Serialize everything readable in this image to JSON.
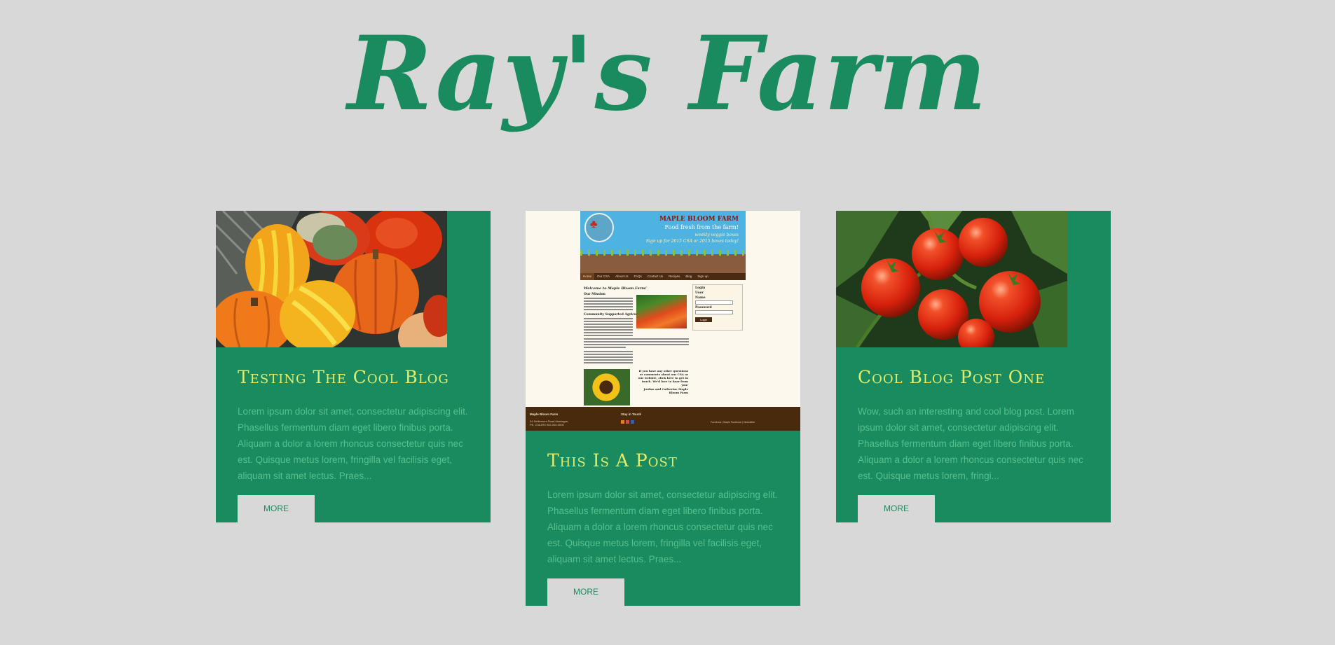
{
  "site": {
    "title": "Ray's Farm"
  },
  "posts": [
    {
      "title": "Testing The Cool Blog",
      "excerpt": "Lorem ipsum dolor sit amet, consectetur adipiscing elit. Phasellus fermentum diam eget libero finibus porta. Aliquam a dolor a lorem rhoncus consectetur quis nec est. Quisque metus lorem, fringilla vel facilisis eget, aliquam sit amet lectus. Praes...",
      "more_label": "MORE",
      "image": "pumpkins-and-gourds-photo"
    },
    {
      "title": "This Is A Post",
      "excerpt": "Lorem ipsum dolor sit amet, consectetur adipiscing elit. Phasellus fermentum diam eget libero finibus porta. Aliquam a dolor a lorem rhoncus consectetur quis nec est. Quisque metus lorem, fringilla vel facilisis eget, aliquam sit amet lectus. Praes...",
      "more_label": "MORE",
      "image": "website-screenshot"
    },
    {
      "title": "Cool Blog Post One",
      "excerpt": "Wow, such an interesting and cool blog post.    Lorem ipsum dolor sit amet, consectetur adipiscing elit. Phasellus fermentum diam eget libero finibus porta. Aliquam a dolor a lorem rhoncus consectetur quis nec est. Quisque metus lorem, fringi...",
      "more_label": "MORE",
      "image": "tomatoes-on-vine-photo"
    }
  ],
  "screenshot": {
    "brand": "MAPLE BLOOM FARM",
    "tagline": "Food fresh from the farm!",
    "sub1": "weekly veggie boxes",
    "sub2": "Sign up for 2015 CSA or 2015 boxes today!",
    "nav": [
      "Home",
      "Our CSA",
      "About Us",
      "FAQs",
      "Contact Us",
      "Recipes",
      "Blog",
      "Sign up"
    ],
    "welcome": "Welcome to Maple Bloom Farm!",
    "mission_heading": "Our Mission",
    "csa_heading": "Community Supported Agriculture (CSA)",
    "login": {
      "title": "Login",
      "user_label": "User",
      "name_label": "Name",
      "password_label": "Password",
      "button": "Login"
    },
    "question": "If you have any other questions or comments about our CSA or our website, click here to get in touch. We'd love to hear from you!",
    "signoff": "Jordan and Catherine Maple Bloom Farm",
    "footer": {
      "name": "Maple Bloom Farm",
      "address": "34 Settlement Road Montague, PE, C0A1R0 902-000-0000",
      "touch": "Stay in Touch",
      "links": "Facebook | Maple Facebook | Newsletter"
    }
  },
  "colors": {
    "background": "#d8d8d8",
    "card": "#1a8b5e",
    "title": "#1a8b5e",
    "post_title": "#e0ec6c",
    "excerpt": "#56c08f"
  }
}
